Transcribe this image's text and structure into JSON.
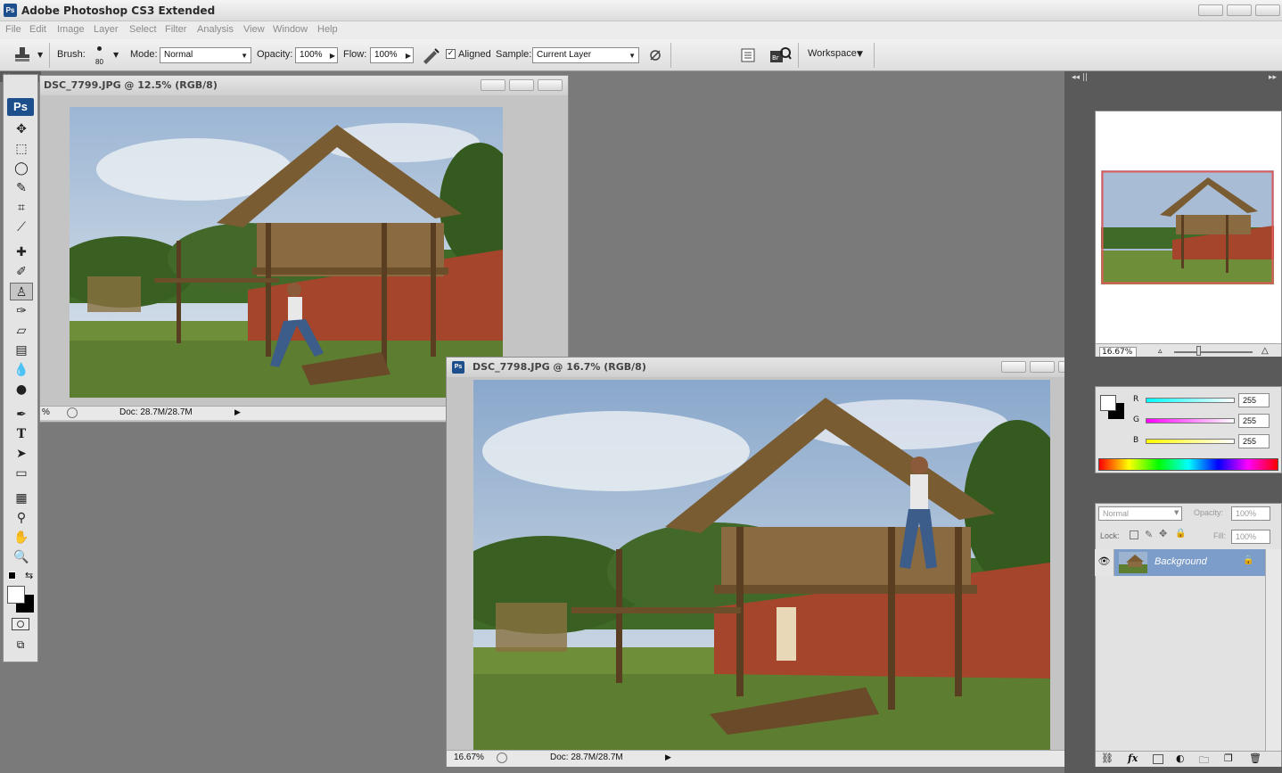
{
  "app": {
    "logo": "Ps",
    "title": "Adobe Photoshop CS3 Extended"
  },
  "menu": [
    "File",
    "Edit",
    "Image",
    "Layer",
    "Select",
    "Filter",
    "Analysis",
    "View",
    "Window",
    "Help"
  ],
  "options": {
    "brush_label": "Brush:",
    "brush_size": "80",
    "mode_label": "Mode:",
    "mode_value": "Normal",
    "opacity_label": "Opacity:",
    "opacity_value": "100%",
    "flow_label": "Flow:",
    "flow_value": "100%",
    "aligned_label": "Aligned",
    "aligned_checked": true,
    "sample_label": "Sample:",
    "sample_value": "Current Layer",
    "workspace_label": "Workspace"
  },
  "toolbox": {
    "logo": "Ps"
  },
  "doc1": {
    "title": "DSC_7799.JPG @ 12.5% (RGB/8)",
    "zoom": "%",
    "docsize": "Doc: 28.7M/28.7M"
  },
  "doc2": {
    "title": "DSC_7798.JPG @ 16.7% (RGB/8)",
    "zoom": "16.67%",
    "docsize": "Doc: 28.7M/28.7M"
  },
  "navigator": {
    "zoom": "16.67%"
  },
  "color": {
    "r_label": "R",
    "g_label": "G",
    "b_label": "B",
    "r": "255",
    "g": "255",
    "b": "255"
  },
  "layers": {
    "blend_mode": "Normal",
    "opacity_label": "Opacity:",
    "opacity": "100%",
    "lock_label": "Lock:",
    "fill_label": "Fill:",
    "fill": "100%",
    "layer_name": "Background"
  },
  "colors": {
    "accent": "#1d4f8c",
    "selected_layer": "#7c9dc9",
    "nav_frame": "#e05a5a"
  }
}
